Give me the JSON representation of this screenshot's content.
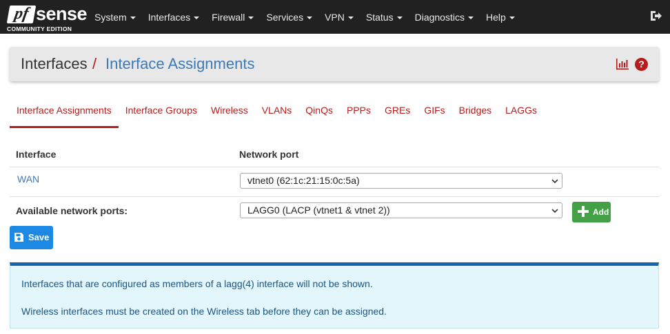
{
  "brand": {
    "logo_pf": "pf",
    "logo_sense": "sense",
    "edition": "COMMUNITY EDITION"
  },
  "nav": {
    "items": [
      {
        "label": "System"
      },
      {
        "label": "Interfaces"
      },
      {
        "label": "Firewall"
      },
      {
        "label": "Services"
      },
      {
        "label": "VPN"
      },
      {
        "label": "Status"
      },
      {
        "label": "Diagnostics"
      },
      {
        "label": "Help"
      }
    ],
    "logout_icon": "logout-icon"
  },
  "header": {
    "crumb_parent": "Interfaces",
    "separator": "/",
    "crumb_current": "Interface Assignments",
    "help_label": "?",
    "icons": [
      "bar-chart-icon",
      "help-icon"
    ]
  },
  "tabs": [
    {
      "label": "Interface Assignments",
      "active": true
    },
    {
      "label": "Interface Groups"
    },
    {
      "label": "Wireless"
    },
    {
      "label": "VLANs"
    },
    {
      "label": "QinQs"
    },
    {
      "label": "PPPs"
    },
    {
      "label": "GREs"
    },
    {
      "label": "GIFs"
    },
    {
      "label": "Bridges"
    },
    {
      "label": "LAGGs"
    }
  ],
  "table": {
    "col_interface": "Interface",
    "col_network_port": "Network port",
    "rows": [
      {
        "interface": "WAN",
        "port": "vtnet0 (62:1c:21:15:0c:5a)"
      }
    ],
    "available_label": "Available network ports:",
    "available_selected": "LAGG0 (LACP (vtnet1 & vtnet 2))",
    "add_label": "Add"
  },
  "save_label": "Save",
  "info": {
    "line1": "Interfaces that are configured as members of a lagg(4) interface will not be shown.",
    "line2": "Wireless interfaces must be created on the Wireless tab before they can be assigned."
  },
  "colors": {
    "navbar": "#212121",
    "accent_red": "#b71c1c",
    "link_blue": "#3b79b7",
    "save_blue": "#1e88e5",
    "add_green": "#43a047",
    "info_bg": "#e3f6fc",
    "info_border": "#1565a8"
  }
}
